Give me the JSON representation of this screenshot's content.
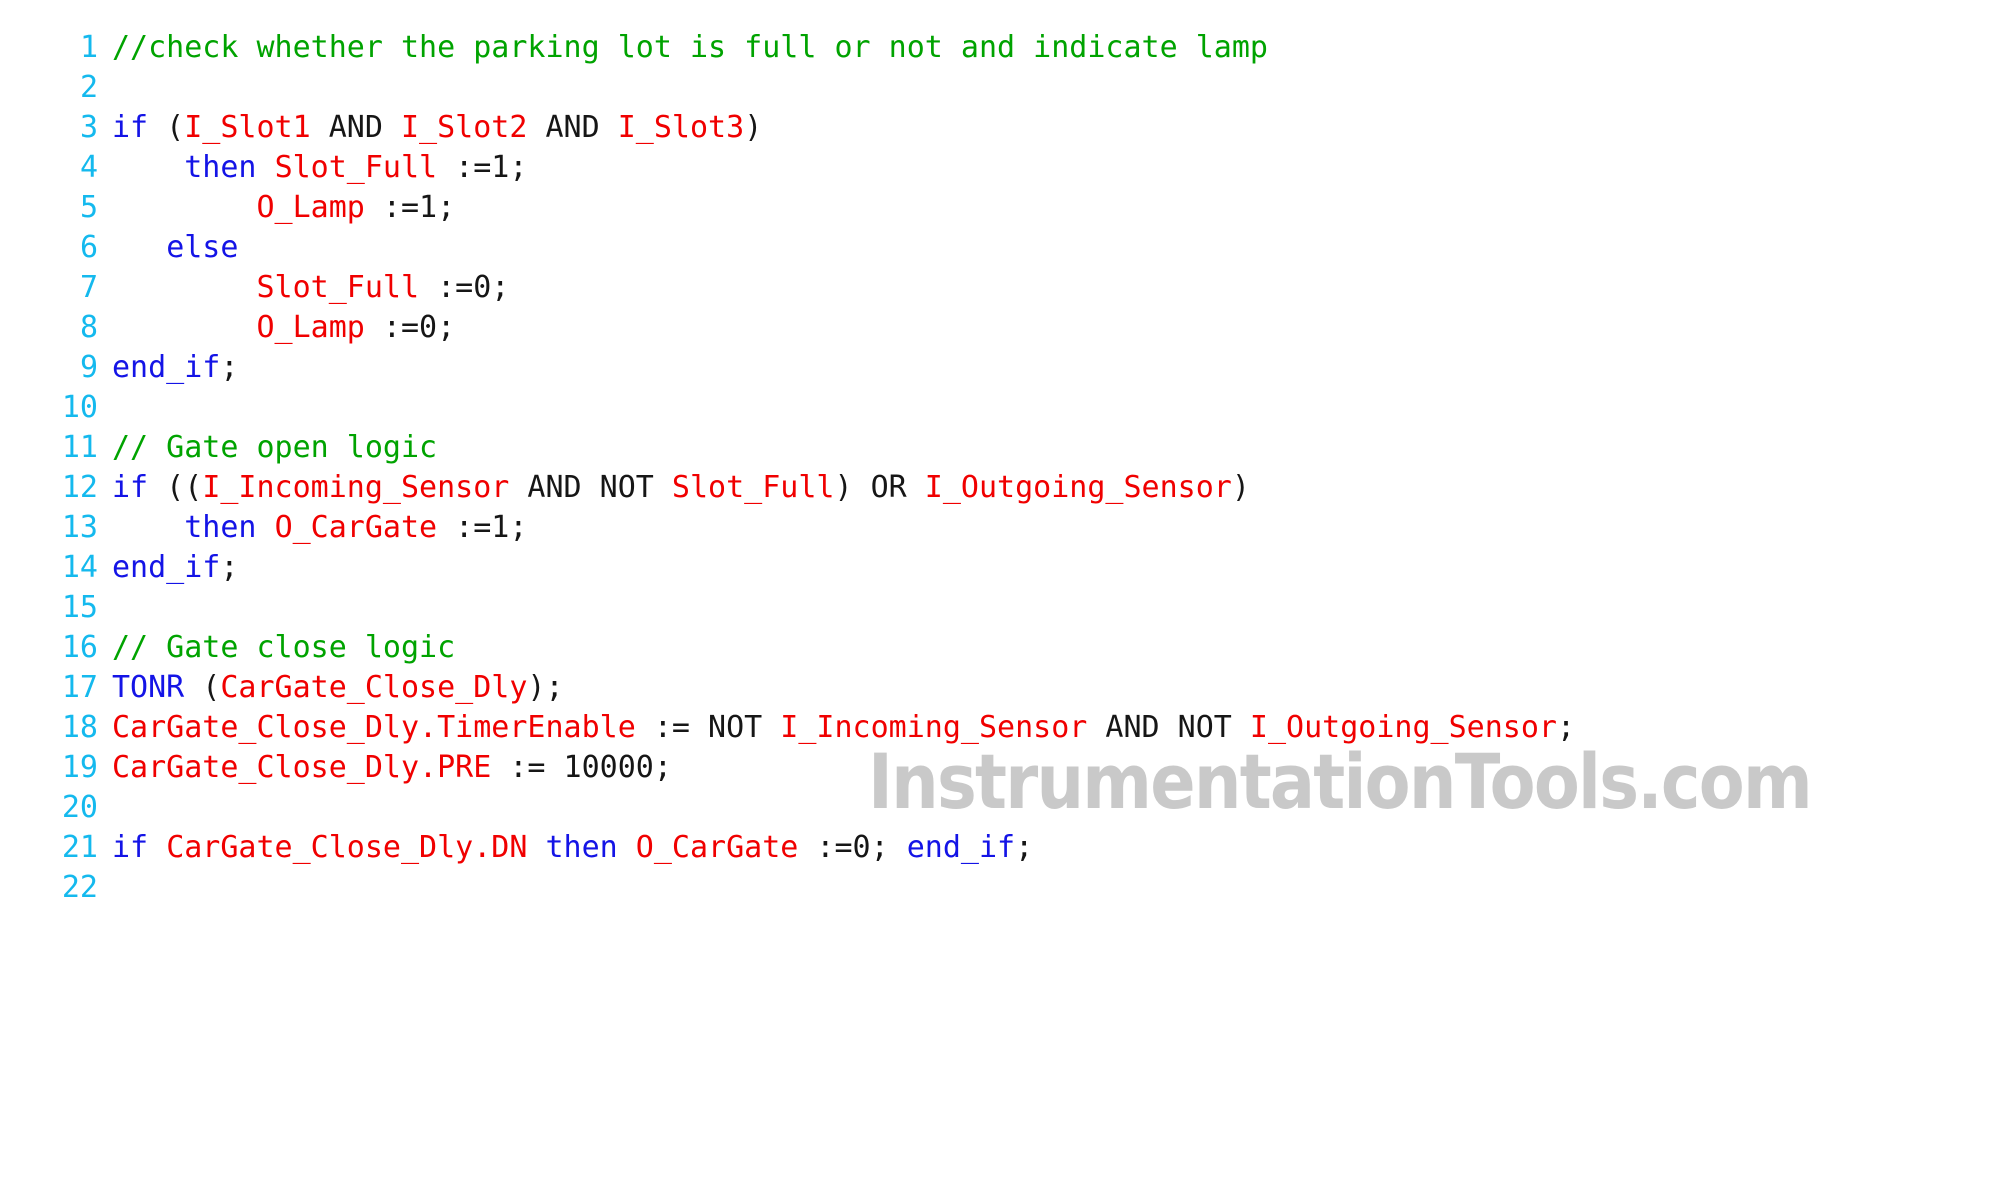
{
  "editor": {
    "language": "Structured Text",
    "background_color": "#ffffff",
    "font_size_px": 30,
    "line_height_px": 40,
    "total_lines": 22
  },
  "watermark": {
    "text": "InstrumentationTools.com",
    "color": "#c9c9c9"
  },
  "theme": {
    "line_number_color": "#14b9ee",
    "comment_color": "#00a300",
    "keyword_color": "#1414e6",
    "identifier_color": "#f00000",
    "plain_color": "#161616"
  },
  "lines": [
    {
      "number": "1",
      "tokens": [
        {
          "t": "//check whether the parking lot is full or not and indicate lamp",
          "c": "comment"
        }
      ]
    },
    {
      "number": "2",
      "tokens": []
    },
    {
      "number": "3",
      "tokens": [
        {
          "t": "if",
          "c": "keyword"
        },
        {
          "t": " (",
          "c": "plain"
        },
        {
          "t": "I_Slot1",
          "c": "ident"
        },
        {
          "t": " AND ",
          "c": "plain"
        },
        {
          "t": "I_Slot2",
          "c": "ident"
        },
        {
          "t": " AND ",
          "c": "plain"
        },
        {
          "t": "I_Slot3",
          "c": "ident"
        },
        {
          "t": ")",
          "c": "plain"
        }
      ]
    },
    {
      "number": "4",
      "tokens": [
        {
          "t": "    ",
          "c": "plain"
        },
        {
          "t": "then",
          "c": "keyword"
        },
        {
          "t": " ",
          "c": "plain"
        },
        {
          "t": "Slot_Full",
          "c": "ident"
        },
        {
          "t": " :=1;",
          "c": "plain"
        }
      ]
    },
    {
      "number": "5",
      "tokens": [
        {
          "t": "        ",
          "c": "plain"
        },
        {
          "t": "O_Lamp",
          "c": "ident"
        },
        {
          "t": " :=1;",
          "c": "plain"
        }
      ]
    },
    {
      "number": "6",
      "tokens": [
        {
          "t": "   ",
          "c": "plain"
        },
        {
          "t": "else",
          "c": "keyword"
        }
      ]
    },
    {
      "number": "7",
      "tokens": [
        {
          "t": "        ",
          "c": "plain"
        },
        {
          "t": "Slot_Full",
          "c": "ident"
        },
        {
          "t": " :=0;",
          "c": "plain"
        }
      ]
    },
    {
      "number": "8",
      "tokens": [
        {
          "t": "        ",
          "c": "plain"
        },
        {
          "t": "O_Lamp",
          "c": "ident"
        },
        {
          "t": " :=0;",
          "c": "plain"
        }
      ]
    },
    {
      "number": "9",
      "tokens": [
        {
          "t": "end_if",
          "c": "keyword"
        },
        {
          "t": ";",
          "c": "plain"
        }
      ]
    },
    {
      "number": "10",
      "tokens": []
    },
    {
      "number": "11",
      "tokens": [
        {
          "t": "// Gate open logic",
          "c": "comment"
        }
      ]
    },
    {
      "number": "12",
      "tokens": [
        {
          "t": "if",
          "c": "keyword"
        },
        {
          "t": " ((",
          "c": "plain"
        },
        {
          "t": "I_Incoming_Sensor",
          "c": "ident"
        },
        {
          "t": " AND NOT ",
          "c": "plain"
        },
        {
          "t": "Slot_Full",
          "c": "ident"
        },
        {
          "t": ") OR ",
          "c": "plain"
        },
        {
          "t": "I_Outgoing_Sensor",
          "c": "ident"
        },
        {
          "t": ")",
          "c": "plain"
        }
      ]
    },
    {
      "number": "13",
      "tokens": [
        {
          "t": "    ",
          "c": "plain"
        },
        {
          "t": "then",
          "c": "keyword"
        },
        {
          "t": " ",
          "c": "plain"
        },
        {
          "t": "O_CarGate",
          "c": "ident"
        },
        {
          "t": " :=1;",
          "c": "plain"
        }
      ]
    },
    {
      "number": "14",
      "tokens": [
        {
          "t": "end_if",
          "c": "keyword"
        },
        {
          "t": ";",
          "c": "plain"
        }
      ]
    },
    {
      "number": "15",
      "tokens": []
    },
    {
      "number": "16",
      "tokens": [
        {
          "t": "// Gate close logic",
          "c": "comment"
        }
      ]
    },
    {
      "number": "17",
      "tokens": [
        {
          "t": "TONR",
          "c": "keyword"
        },
        {
          "t": " (",
          "c": "plain"
        },
        {
          "t": "CarGate_Close_Dly",
          "c": "ident"
        },
        {
          "t": ");",
          "c": "plain"
        }
      ]
    },
    {
      "number": "18",
      "tokens": [
        {
          "t": "CarGate_Close_Dly.TimerEnable",
          "c": "ident"
        },
        {
          "t": " := NOT ",
          "c": "plain"
        },
        {
          "t": "I_Incoming_Sensor",
          "c": "ident"
        },
        {
          "t": " AND NOT ",
          "c": "plain"
        },
        {
          "t": "I_Outgoing_Sensor",
          "c": "ident"
        },
        {
          "t": ";",
          "c": "plain"
        }
      ]
    },
    {
      "number": "19",
      "tokens": [
        {
          "t": "CarGate_Close_Dly.PRE",
          "c": "ident"
        },
        {
          "t": " := 10000;",
          "c": "plain"
        }
      ]
    },
    {
      "number": "20",
      "tokens": []
    },
    {
      "number": "21",
      "tokens": [
        {
          "t": "if",
          "c": "keyword"
        },
        {
          "t": " ",
          "c": "plain"
        },
        {
          "t": "CarGate_Close_Dly.DN",
          "c": "ident"
        },
        {
          "t": " ",
          "c": "plain"
        },
        {
          "t": "then",
          "c": "keyword"
        },
        {
          "t": " ",
          "c": "plain"
        },
        {
          "t": "O_CarGate",
          "c": "ident"
        },
        {
          "t": " :=0; ",
          "c": "plain"
        },
        {
          "t": "end_if",
          "c": "keyword"
        },
        {
          "t": ";",
          "c": "plain"
        }
      ]
    },
    {
      "number": "22",
      "tokens": []
    }
  ]
}
